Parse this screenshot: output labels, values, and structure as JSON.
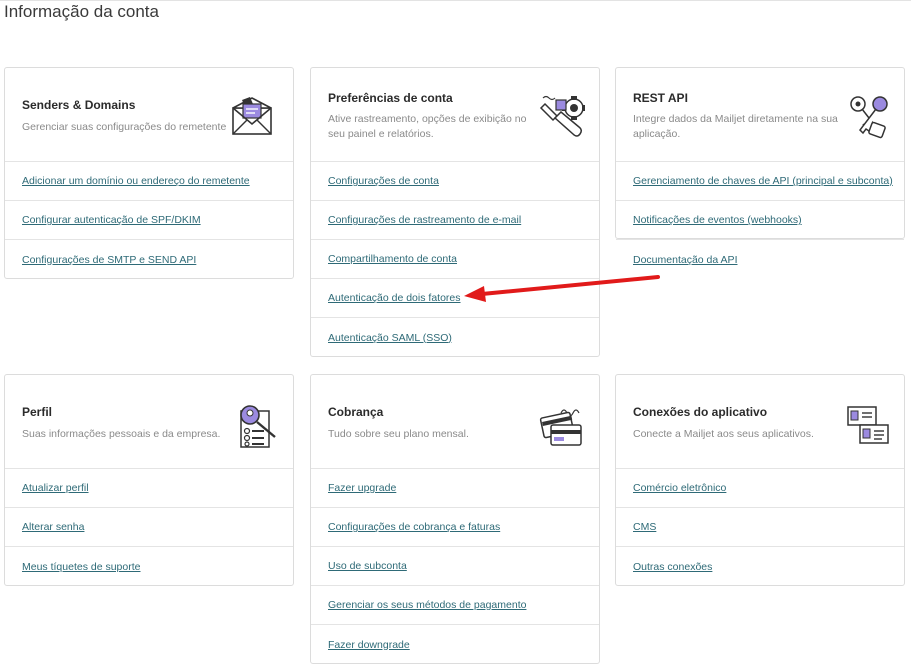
{
  "page": {
    "title": "Informação da conta"
  },
  "cards": [
    {
      "title": "Senders & Domains",
      "desc": "Gerenciar suas configurações do remetente",
      "icon": "envelope-icon",
      "links": [
        "Adicionar um domínio ou endereço do remetente",
        "Configurar autenticação de SPF/DKIM",
        "Configurações de SMTP e SEND API"
      ]
    },
    {
      "title": "Preferências de conta",
      "desc": "Ative rastreamento, opções de exibição no seu painel e relatórios.",
      "icon": "wrench-gear-icon",
      "links": [
        "Configurações de conta",
        "Configurações de rastreamento de e-mail",
        "Compartilhamento de conta",
        "Autenticação de dois fatores",
        "Autenticação SAML (SSO)"
      ]
    },
    {
      "title": "REST API",
      "desc": "Integre dados da Mailjet diretamente na sua aplicação.",
      "icon": "keys-icon",
      "links": [
        "Gerenciamento de chaves de API (principal e subconta)",
        "Notificações de eventos (webhooks)",
        "Documentação da API"
      ]
    },
    {
      "title": "Perfil",
      "desc": "Suas informações pessoais e da empresa.",
      "icon": "profile-magnifier-icon",
      "links": [
        "Atualizar perfil",
        "Alterar senha",
        "Meus tíquetes de suporte"
      ]
    },
    {
      "title": "Cobrança",
      "desc": "Tudo sobre seu plano mensal.",
      "icon": "credit-cards-icon",
      "links": [
        "Fazer upgrade",
        "Configurações de cobrança e faturas",
        "Uso de subconta",
        "Gerenciar os seus métodos de pagamento",
        "Fazer downgrade"
      ]
    },
    {
      "title": "Conexões do aplicativo",
      "desc": "Conecte a Mailjet aos seus aplicativos.",
      "icon": "plugin-cards-icon",
      "links": [
        "Comércio eletrônico",
        "CMS",
        "Outras conexões"
      ]
    }
  ],
  "annotation": {
    "color": "#e11a1a",
    "icon": "red-arrow-icon"
  }
}
